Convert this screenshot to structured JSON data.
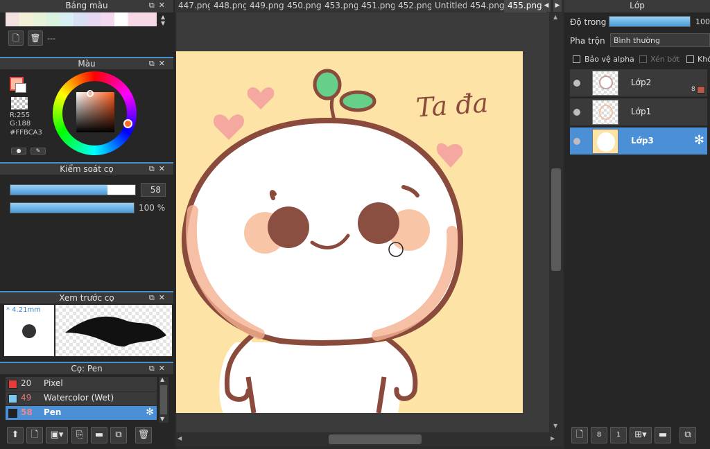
{
  "palette_panel": {
    "title": "Bảng màu",
    "sep_text": "---"
  },
  "color_panel": {
    "title": "Màu",
    "r": "R:255",
    "g": "G:188",
    "hex": "#FFBCA3",
    "fg_color": "#FFBCA3"
  },
  "brush_control": {
    "title": "Kiểm soát cọ",
    "size_value": "58",
    "size_fraction": 0.78,
    "opacity_value": "100 %",
    "opacity_fraction": 1.0
  },
  "brush_preview": {
    "title": "Xem trước cọ",
    "size_label": "* 4.21mm"
  },
  "brush_list": {
    "title": "Cọ: Pen",
    "items": [
      {
        "number": "20",
        "name": "Pixel",
        "color": "#e83c3c",
        "num_color": "#e8e8e8",
        "selected": false
      },
      {
        "number": "49",
        "name": "Watercolor (Wet)",
        "color": "#7cc8f0",
        "num_color": "#e07a7a",
        "selected": false
      },
      {
        "number": "58",
        "name": "Pen",
        "color": "#222222",
        "num_color": "#f08a8a",
        "selected": true
      }
    ],
    "gear_icon": "gear-icon"
  },
  "tabs": [
    "447.png",
    "448.png",
    "449.png",
    "450.png",
    "453.png",
    "451.png",
    "452.png",
    "Untitled",
    "454.png",
    "455.png"
  ],
  "active_tab": "455.png",
  "canvas": {
    "background": "#FEE3A6",
    "text": "Ta đa"
  },
  "layers_panel": {
    "title": "Lớp",
    "opacity_label": "Độ trong",
    "opacity_value": "100",
    "blend_label": "Pha trộn",
    "blend_value": "Bình thường",
    "protect_alpha": "Bảo vệ alpha",
    "clipping": "Xén bớt",
    "lock": "Khó",
    "layers": [
      {
        "name": "Lớp2",
        "badge": "8"
      },
      {
        "name": "Lớp1",
        "badge": ""
      },
      {
        "name": "Lớp3",
        "badge": ""
      }
    ]
  }
}
